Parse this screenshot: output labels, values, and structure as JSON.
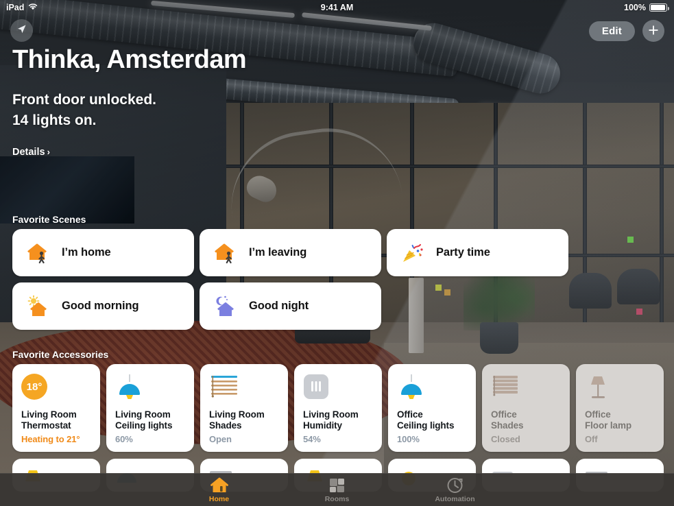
{
  "status_bar": {
    "device": "iPad",
    "wifi_icon": "wifi-icon",
    "time": "9:41 AM",
    "battery_percent": "100%",
    "battery_icon": "battery-full-icon"
  },
  "header": {
    "location_icon": "location-arrow-icon",
    "edit_label": "Edit",
    "add_label": "+",
    "add_icon": "plus-icon"
  },
  "hero": {
    "home_name": "Thinka, Amsterdam",
    "status_line_1": "Front door unlocked.",
    "status_line_2": "14 lights on.",
    "details_label": "Details",
    "details_chevron": "›"
  },
  "scenes": {
    "section_title": "Favorite Scenes",
    "items": [
      {
        "label": "I’m home",
        "icon": "house-walk-icon",
        "icon_color": "#f5901e"
      },
      {
        "label": "I’m leaving",
        "icon": "house-walk-icon",
        "icon_color": "#f5901e"
      },
      {
        "label": "Party time",
        "icon": "party-popper-icon",
        "icon_color": "#f7c948"
      },
      {
        "label": "Good morning",
        "icon": "house-sun-icon",
        "icon_color": "#f5901e"
      },
      {
        "label": "Good night",
        "icon": "house-moon-icon",
        "icon_color": "#7b7fe0"
      }
    ]
  },
  "accessories": {
    "section_title": "Favorite Accessories",
    "items": [
      {
        "name": "Living Room\nThermostat",
        "name_l1": "Living Room",
        "name_l2": "Thermostat",
        "state": "Heating to 21°",
        "icon": "thermostat-dial-icon",
        "badge": "18°",
        "on": true,
        "state_style": "heat"
      },
      {
        "name": "Living Room\nCeiling lights",
        "name_l1": "Living Room",
        "name_l2": "Ceiling lights",
        "state": "60%",
        "icon": "pendant-lamp-icon",
        "badge": "",
        "on": true,
        "state_style": "normal"
      },
      {
        "name": "Living Room\nShades",
        "name_l1": "Living Room",
        "name_l2": "Shades",
        "state": "Open",
        "icon": "blinds-open-icon",
        "badge": "",
        "on": true,
        "state_style": "normal"
      },
      {
        "name": "Living Room\nHumidity",
        "name_l1": "Living Room",
        "name_l2": "Humidity",
        "state": "54%",
        "icon": "humidity-sensor-icon",
        "badge": "",
        "on": true,
        "state_style": "normal"
      },
      {
        "name": "Office\nCeiling lights",
        "name_l1": "Office",
        "name_l2": "Ceiling lights",
        "state": "100%",
        "icon": "pendant-lamp-icon",
        "badge": "",
        "on": true,
        "state_style": "normal"
      },
      {
        "name": "Office\nShades",
        "name_l1": "Office",
        "name_l2": "Shades",
        "state": "Closed",
        "icon": "blinds-closed-icon",
        "badge": "",
        "on": false,
        "state_style": "normal"
      },
      {
        "name": "Office\nFloor lamp",
        "name_l1": "Office",
        "name_l2": "Floor lamp",
        "state": "Off",
        "icon": "floor-lamp-icon",
        "badge": "",
        "on": false,
        "state_style": "normal"
      }
    ],
    "row2_icons": [
      {
        "icon": "lamp-on-icon",
        "on": true
      },
      {
        "icon": "pendant-lamp-icon",
        "on": true
      },
      {
        "icon": "blinds-icon",
        "on": true
      },
      {
        "icon": "lamp-on-icon",
        "on": true
      },
      {
        "icon": "lamp-on-icon",
        "on": true
      },
      {
        "icon": "lamp-off-icon",
        "on": true
      },
      {
        "icon": "blinds-icon",
        "on": true
      }
    ]
  },
  "tab_bar": {
    "tabs": [
      {
        "label": "Home",
        "icon": "house-icon",
        "active": true
      },
      {
        "label": "Rooms",
        "icon": "rooms-icon",
        "active": false
      },
      {
        "label": "Automation",
        "icon": "clock-arrow-icon",
        "active": false
      }
    ]
  },
  "colors": {
    "accent_orange": "#f5901e",
    "tab_active": "#f6a124",
    "card_white": "#ffffff",
    "card_off": "#d7d4d1",
    "state_blue_gray": "#8d99a6",
    "tab_bar_bg": "#3a3734"
  }
}
